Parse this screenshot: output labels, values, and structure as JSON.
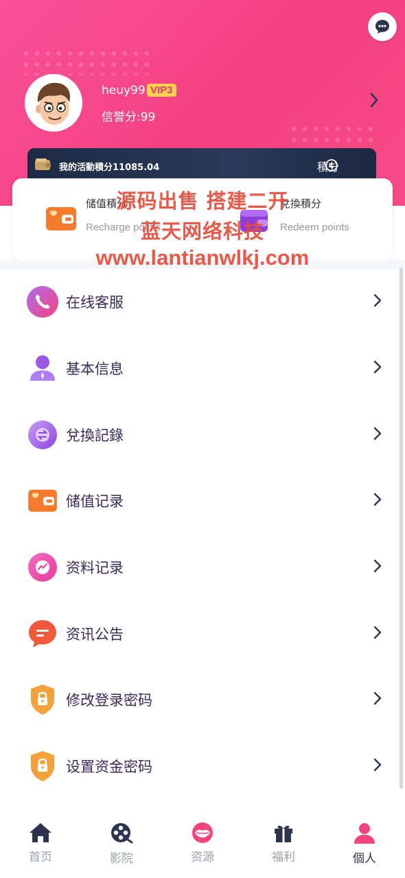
{
  "profile": {
    "username": "heuy99",
    "vip": "VIP3",
    "credit": "信誉分:99"
  },
  "points_bar": {
    "label": "我的活動積分11085.04",
    "right_label": "積分"
  },
  "card": {
    "left_title": "储值積分",
    "left_sub": "Recharge points",
    "right_title": "兌換積分",
    "right_sub": "Redeem points"
  },
  "watermark": {
    "line1": "源码出售 搭建二开",
    "line2": "蓝天网络科技",
    "line3": "www.lantianwlkj.com"
  },
  "menu": [
    {
      "label": "在线客服",
      "icon": "phone-icon"
    },
    {
      "label": "基本信息",
      "icon": "user-icon"
    },
    {
      "label": "兌換記錄",
      "icon": "exchange-icon"
    },
    {
      "label": "储值记录",
      "icon": "wallet-icon"
    },
    {
      "label": "资料记录",
      "icon": "chart-icon"
    },
    {
      "label": "资讯公告",
      "icon": "message-icon"
    },
    {
      "label": "修改登录密码",
      "icon": "lock-shield-icon"
    },
    {
      "label": "设置资金密码",
      "icon": "lock-shield-icon"
    }
  ],
  "tabs": [
    {
      "label": "首页",
      "icon": "home-icon"
    },
    {
      "label": "影院",
      "icon": "film-reel-icon"
    },
    {
      "label": "资源",
      "icon": "lips-icon"
    },
    {
      "label": "福利",
      "icon": "gift-icon"
    },
    {
      "label": "個人",
      "icon": "person-icon",
      "active": true
    }
  ],
  "colors": {
    "header_pink": "#f4417f",
    "points_bar": "#1d2a45",
    "menu_text": "#3a2a5c",
    "tab_active": "#2c3550",
    "tab_inactive": "#9aa0ad"
  }
}
